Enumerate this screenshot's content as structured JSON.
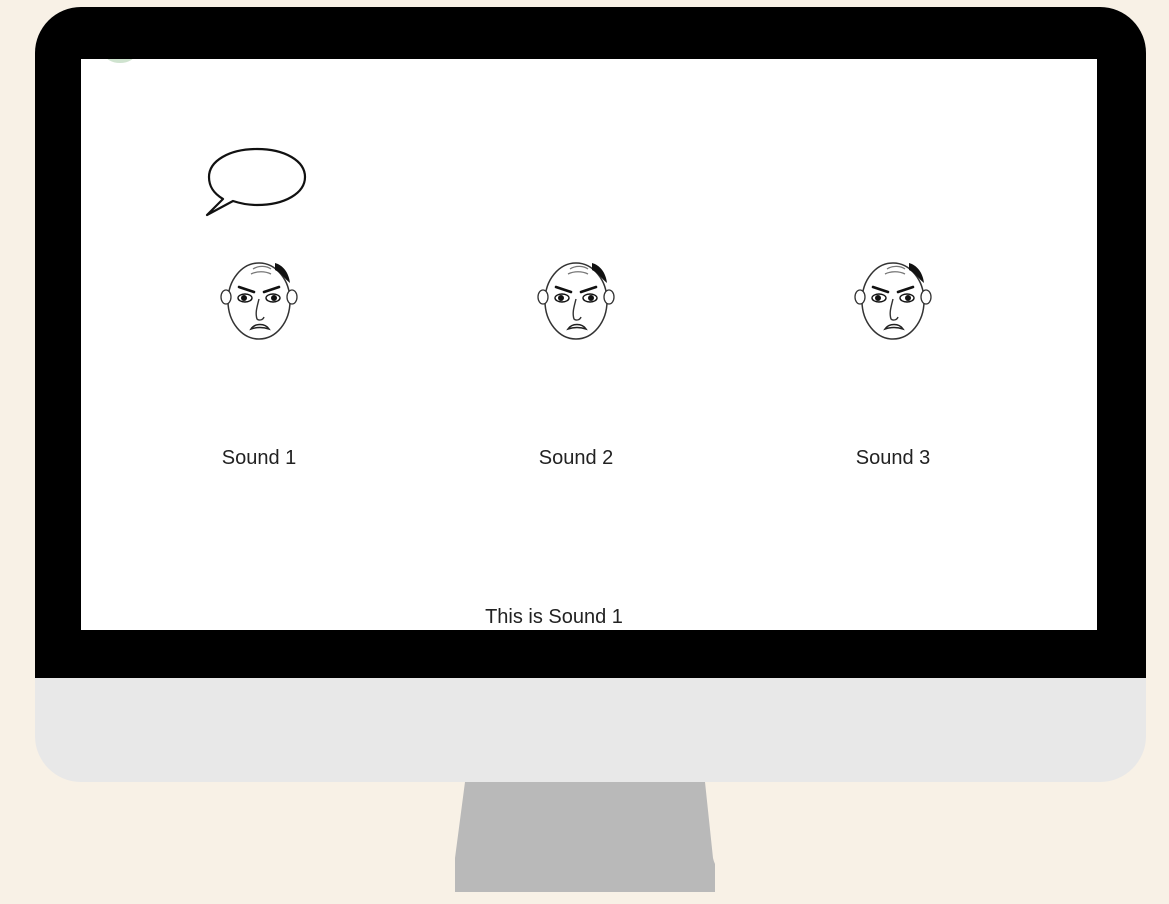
{
  "sounds": [
    {
      "label": "Sound 1"
    },
    {
      "label": "Sound 2"
    },
    {
      "label": "Sound 3"
    }
  ],
  "caption": "This is Sound 1",
  "icons": {
    "speech": "speech-bubble-icon",
    "face": "angry-face-icon"
  },
  "colors": {
    "background": "#f8f1e6",
    "bezel": "#000000",
    "chin": "#e8e8e8",
    "stand": "#b9b9b9",
    "screen": "#ffffff"
  }
}
